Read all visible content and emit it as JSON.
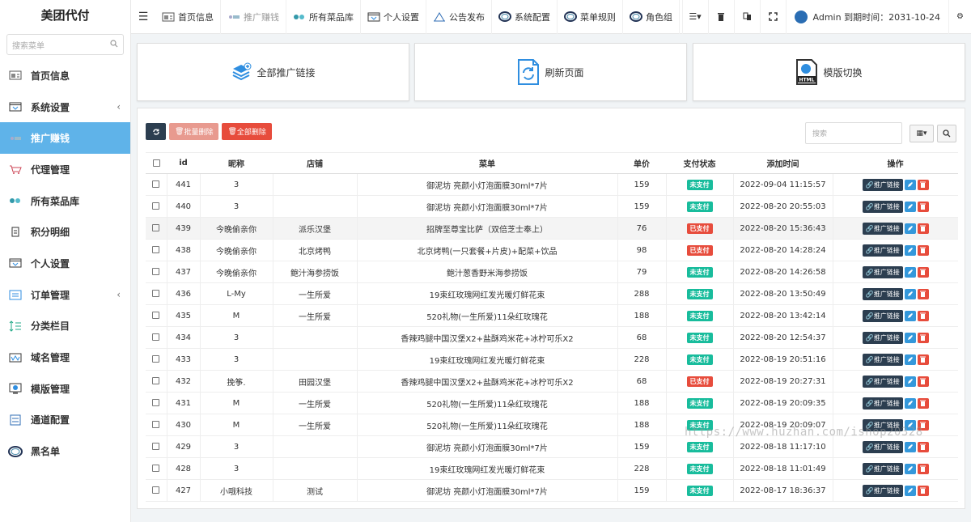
{
  "app": {
    "title": "美团代付"
  },
  "sidebar": {
    "search_placeholder": "搜索菜单",
    "items": [
      {
        "label": "首页信息",
        "icon": "dashboard-icon",
        "chevron": ""
      },
      {
        "label": "系统设置",
        "icon": "settings-window-icon",
        "chevron": "‹"
      },
      {
        "label": "推广赚钱",
        "icon": "promo-icon",
        "chevron": ""
      },
      {
        "label": "代理管理",
        "icon": "cart-icon",
        "chevron": ""
      },
      {
        "label": "所有菜品库",
        "icon": "food-library-icon",
        "chevron": ""
      },
      {
        "label": "积分明细",
        "icon": "points-icon",
        "chevron": ""
      },
      {
        "label": "个人设置",
        "icon": "profile-settings-icon",
        "chevron": ""
      },
      {
        "label": "订单管理",
        "icon": "orders-icon",
        "chevron": "‹"
      },
      {
        "label": "分类栏目",
        "icon": "category-icon",
        "chevron": ""
      },
      {
        "label": "域名管理",
        "icon": "domain-icon",
        "chevron": ""
      },
      {
        "label": "模版管理",
        "icon": "template-icon",
        "chevron": ""
      },
      {
        "label": "通道配置",
        "icon": "channel-icon",
        "chevron": ""
      },
      {
        "label": "黑名单",
        "icon": "blacklist-icon",
        "chevron": ""
      }
    ],
    "active_index": 2
  },
  "topbar": {
    "nav": [
      {
        "label": "首页信息",
        "icon": "dashboard-icon"
      },
      {
        "label": "推广赚钱",
        "icon": "promo-icon"
      },
      {
        "label": "所有菜品库",
        "icon": "food-library-icon"
      },
      {
        "label": "个人设置",
        "icon": "profile-settings-icon"
      },
      {
        "label": "公告发布",
        "icon": "announcement-icon"
      },
      {
        "label": "系统配置",
        "icon": "ring-icon"
      },
      {
        "label": "菜单规则",
        "icon": "ring-icon"
      },
      {
        "label": "角色组",
        "icon": "ring-icon"
      }
    ],
    "user": "Admin 到期时间：2031-10-24"
  },
  "cards": [
    {
      "label": "全部推广链接",
      "icon": "layers-add-icon"
    },
    {
      "label": "刷新页面",
      "icon": "refresh-doc-icon"
    },
    {
      "label": "模版切换",
      "icon": "html-file-icon"
    }
  ],
  "toolbar": {
    "batch_delete": "批量删除",
    "delete_all": "全部删除",
    "search_placeholder": "搜索"
  },
  "table": {
    "columns": [
      "id",
      "昵称",
      "店铺",
      "菜单",
      "单价",
      "支付状态",
      "添加时间",
      "操作"
    ],
    "op_link_label": "推广链接",
    "rows": [
      {
        "id": "441",
        "nick": "3",
        "shop": "",
        "menu": "御泥坊 亮颜小灯泡面膜30ml*7片",
        "price": "159",
        "status": "未支付",
        "time": "2022-09-04 11:15:57"
      },
      {
        "id": "440",
        "nick": "3",
        "shop": "",
        "menu": "御泥坊 亮颜小灯泡面膜30ml*7片",
        "price": "159",
        "status": "未支付",
        "time": "2022-08-20 20:55:03"
      },
      {
        "id": "439",
        "nick": "今晚偷亲你",
        "shop": "派乐汉堡",
        "menu": "招牌至尊宝比萨（双倍芝士奉上）",
        "price": "76",
        "status": "已支付",
        "time": "2022-08-20 15:36:43"
      },
      {
        "id": "438",
        "nick": "今晚偷亲你",
        "shop": "北京烤鸭",
        "menu": "北京烤鸭(一只套餐+片皮)+配菜+饮品",
        "price": "98",
        "status": "已支付",
        "time": "2022-08-20 14:28:24"
      },
      {
        "id": "437",
        "nick": "今晚偷亲你",
        "shop": "鲍汁海参捞饭",
        "menu": "鲍汁葱香野米海参捞饭",
        "price": "79",
        "status": "未支付",
        "time": "2022-08-20 14:26:58"
      },
      {
        "id": "436",
        "nick": "L-My",
        "shop": "一生所爱",
        "menu": "19束红玫瑰网红发光暖灯鲜花束",
        "price": "288",
        "status": "未支付",
        "time": "2022-08-20 13:50:49"
      },
      {
        "id": "435",
        "nick": "M",
        "shop": "一生所爱",
        "menu": "520礼物(一生所爱)11朵红玫瑰花",
        "price": "188",
        "status": "未支付",
        "time": "2022-08-20 13:42:14"
      },
      {
        "id": "434",
        "nick": "3",
        "shop": "",
        "menu": "香辣鸡腿中国汉堡X2+盐酥鸡米花+冰柠可乐X2",
        "price": "68",
        "status": "未支付",
        "time": "2022-08-20 12:54:37"
      },
      {
        "id": "433",
        "nick": "3",
        "shop": "",
        "menu": "19束红玫瑰网红发光暖灯鲜花束",
        "price": "228",
        "status": "未支付",
        "time": "2022-08-19 20:51:16"
      },
      {
        "id": "432",
        "nick": "挽筝.",
        "shop": "田园汉堡",
        "menu": "香辣鸡腿中国汉堡X2+盐酥鸡米花+冰柠可乐X2",
        "price": "68",
        "status": "已支付",
        "time": "2022-08-19 20:27:31"
      },
      {
        "id": "431",
        "nick": "M",
        "shop": "一生所爱",
        "menu": "520礼物(一生所爱)11朵红玫瑰花",
        "price": "188",
        "status": "未支付",
        "time": "2022-08-19 20:09:35"
      },
      {
        "id": "430",
        "nick": "M",
        "shop": "一生所爱",
        "menu": "520礼物(一生所爱)11朵红玫瑰花",
        "price": "188",
        "status": "未支付",
        "time": "2022-08-19 20:09:07"
      },
      {
        "id": "429",
        "nick": "3",
        "shop": "",
        "menu": "御泥坊 亮颜小灯泡面膜30ml*7片",
        "price": "159",
        "status": "未支付",
        "time": "2022-08-18 11:17:10"
      },
      {
        "id": "428",
        "nick": "3",
        "shop": "",
        "menu": "19束红玫瑰网红发光暖灯鲜花束",
        "price": "228",
        "status": "未支付",
        "time": "2022-08-18 11:01:49"
      },
      {
        "id": "427",
        "nick": "小哦科技",
        "shop": "测试",
        "menu": "御泥坊 亮颜小灯泡面膜30ml*7片",
        "price": "159",
        "status": "未支付",
        "time": "2022-08-17 18:36:37"
      }
    ],
    "highlight_row": 2
  },
  "watermark": "https://www.huzhan.com/ishop20328",
  "colors": {
    "active": "#5fb3e9",
    "unpaid": "#18bc9c",
    "paid": "#e74c3c",
    "dark_button": "#2c3e50",
    "edit": "#3498db"
  }
}
